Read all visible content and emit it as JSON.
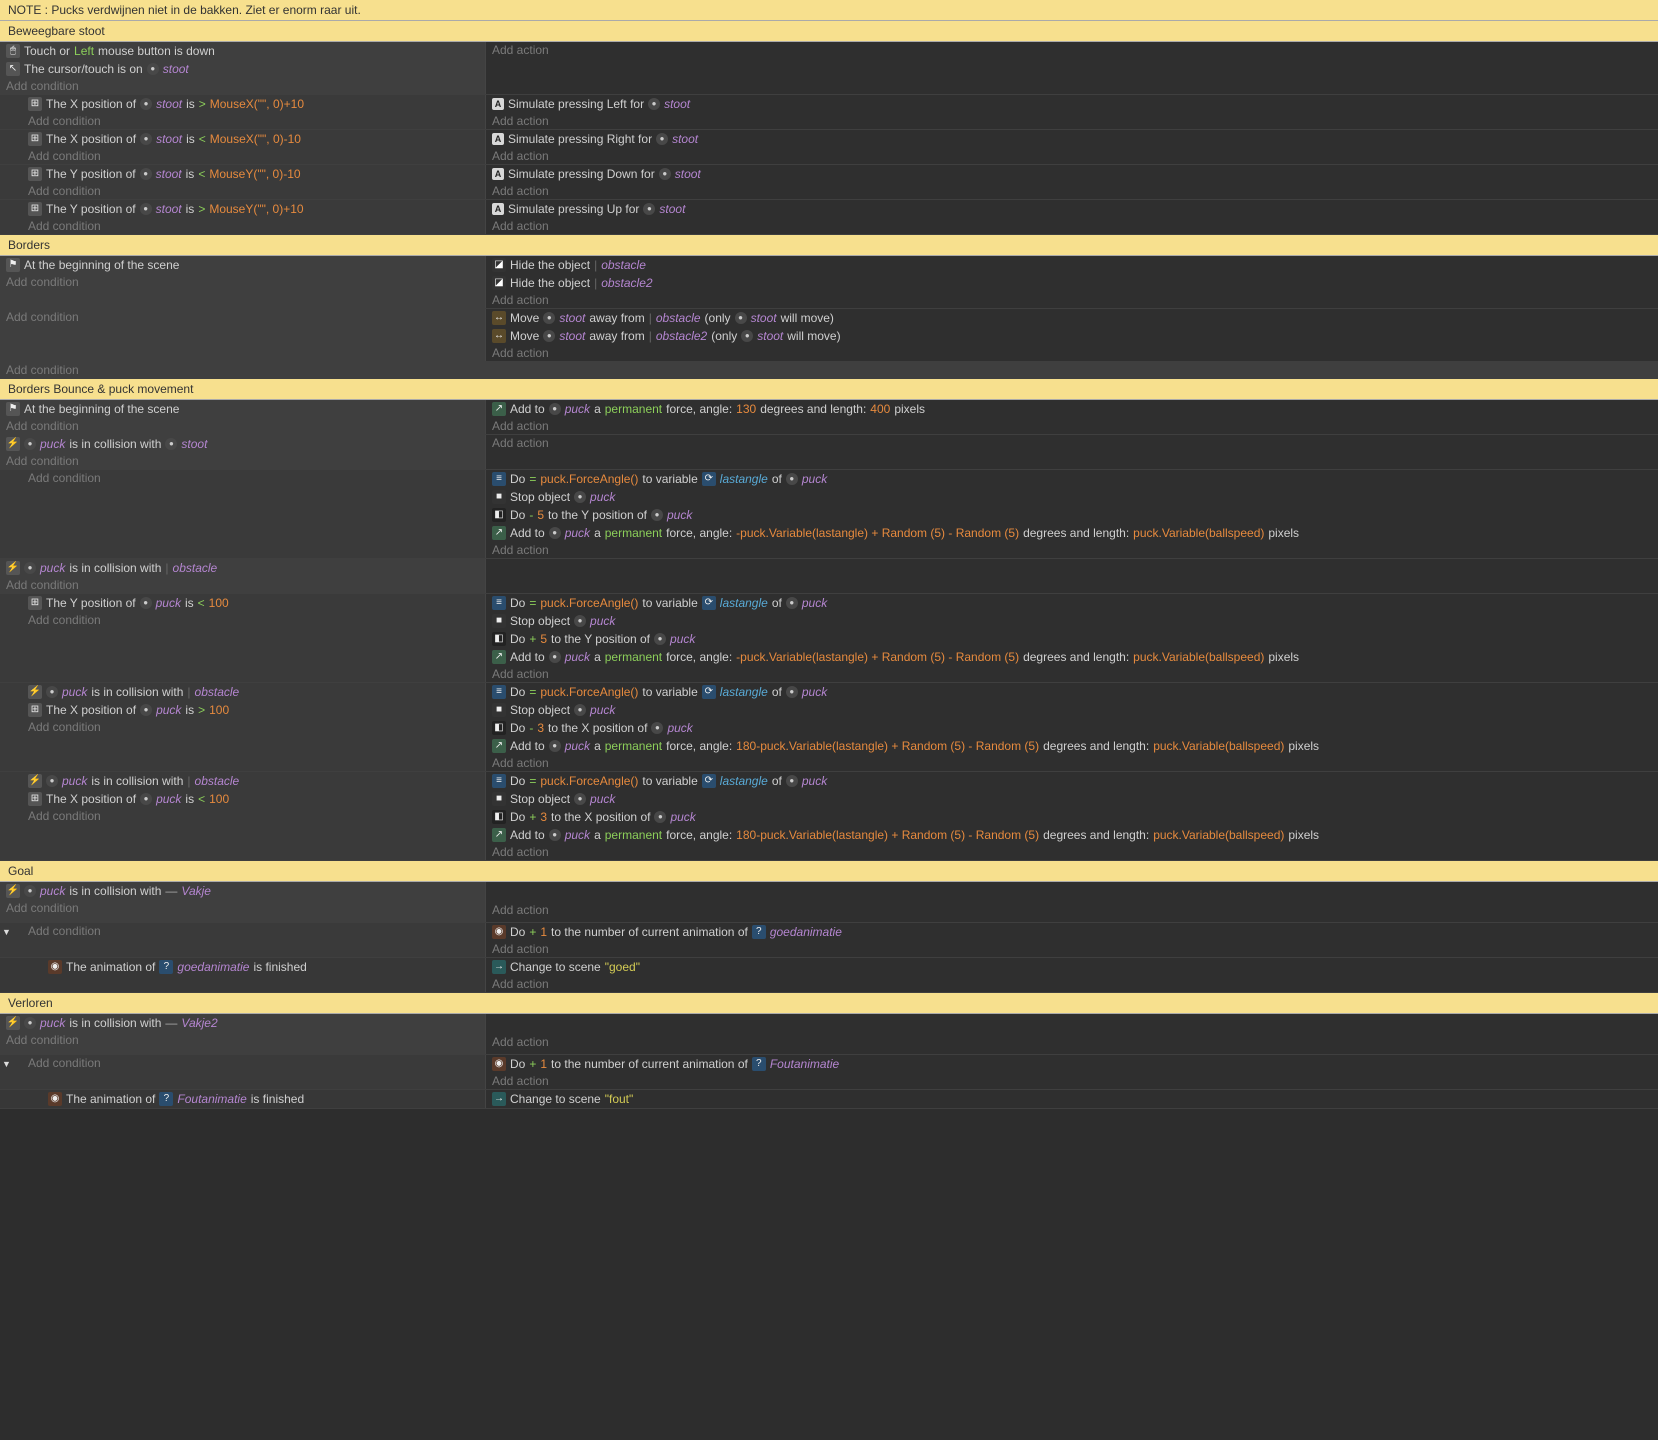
{
  "note": "NOTE : Pucks verdwijnen niet in de bakken. Ziet er enorm raar uit.",
  "add_condition": "Add condition",
  "add_action": "Add action",
  "groups": {
    "beweegbare": "Beweegbare stoot",
    "borders": "Borders",
    "bounce": "Borders Bounce & puck movement",
    "goal": "Goal",
    "verloren": "Verloren"
  },
  "t": {
    "touch_or": "Touch or",
    "left": "Left",
    "mouse_down": "mouse button is down",
    "cursor_on": "The cursor/touch is on",
    "stoot": "stoot",
    "puck": "puck",
    "obstacle": "obstacle",
    "obstacle2": "obstacle2",
    "vakje": "Vakje",
    "vakje2": "Vakje2",
    "goedanim": "goedanimatie",
    "foutanim": "Foutanimatie",
    "x_pos_of": "The X position of",
    "y_pos_of": "The Y position of",
    "is": "is",
    "gt": ">",
    "lt": "<",
    "mouseXp10": "MouseX(\"\", 0)+10",
    "mouseXm10": "MouseX(\"\", 0)-10",
    "mouseYm10": "MouseY(\"\", 0)-10",
    "mouseYp10": "MouseY(\"\", 0)+10",
    "sim_left": "Simulate pressing Left for",
    "sim_right": "Simulate pressing Right for",
    "sim_down": "Simulate pressing Down for",
    "sim_up": "Simulate pressing Up for",
    "begin_scene": "At the beginning of the scene",
    "hide_obj": "Hide the object",
    "move": "Move",
    "away_from": "away from",
    "only": "(only",
    "will_move": "will move)",
    "add_to": "Add to",
    "a": "a",
    "permanent": "permanent",
    "force_angle": "force, angle:",
    "degrees_len": "degrees and length:",
    "pixels": "pixels",
    "n130": "130",
    "n400": "400",
    "coll_with": "is in collision with",
    "do": "Do",
    "eq": "=",
    "forceangle": "puck.ForceAngle()",
    "to_var": "to variable",
    "lastangle": "lastangle",
    "of": "of",
    "stop_obj": "Stop object",
    "minus5": "-5",
    "plus5": "+5",
    "plus3": "+3",
    "minus3": "-3",
    "plus1": "+1",
    "to_ypos_of": "to the Y position of",
    "to_xpos_of": "to the X position of",
    "expr_neg": "-puck.Variable(lastangle) + Random (5) - Random (5)",
    "expr_180": "180-puck.Variable(lastangle) + Random (5) - Random (5)",
    "ballspeed": "puck.Variable(ballspeed)",
    "n100": "100",
    "anim_of": "The animation of",
    "is_finished": "is finished",
    "to_num_anim_of": "to the number of current animation of",
    "change_scene": "Change to scene",
    "goed": "\"goed\"",
    "fout": "\"fout\""
  }
}
